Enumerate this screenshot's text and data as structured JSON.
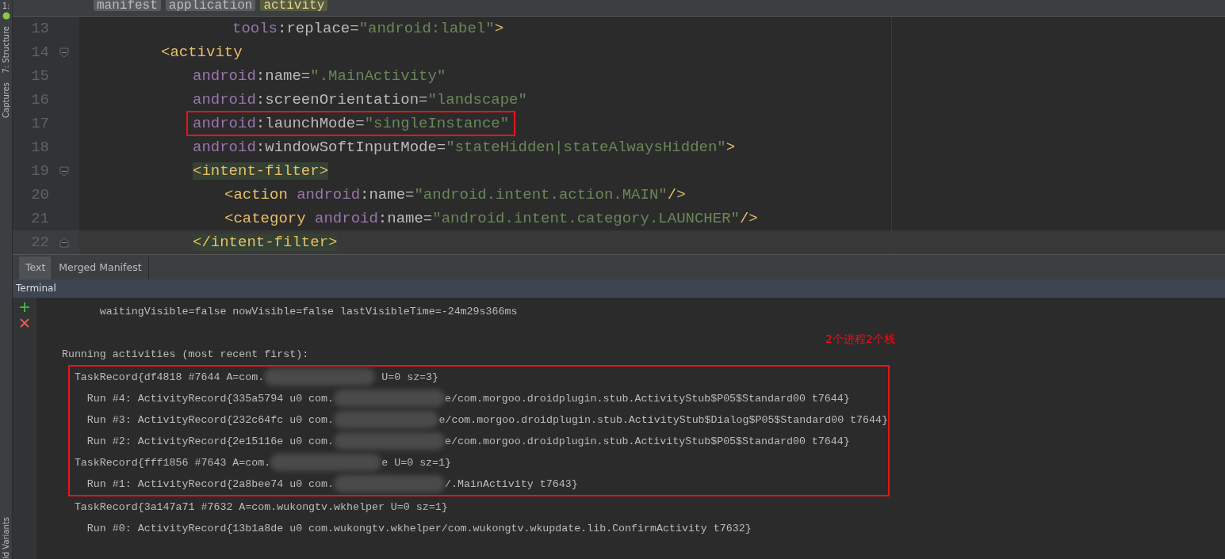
{
  "tool_strip": {
    "top_label": "1:",
    "labels": [
      "7: Structure",
      "Captures"
    ],
    "bottom_label": "ld Variants"
  },
  "breadcrumbs": [
    {
      "label": "manifest",
      "selected": false
    },
    {
      "label": "application",
      "selected": false
    },
    {
      "label": "activity",
      "selected": true
    }
  ],
  "code_lines": [
    {
      "number": "13",
      "kind": "continuation",
      "fold_start": false,
      "fold_end": false,
      "current": false,
      "boxed": false,
      "tokens": [
        {
          "kind": "ns",
          "text": "tools"
        },
        {
          "kind": "punct",
          "text": ":replace="
        },
        {
          "kind": "string",
          "text": "\"android:label\""
        },
        {
          "kind": "tag",
          "text": ">"
        }
      ]
    },
    {
      "number": "14",
      "kind": "element",
      "fold_start": true,
      "fold_end": false,
      "current": false,
      "boxed": false,
      "tokens": [
        {
          "kind": "tag",
          "text": "<activity"
        }
      ],
      "children": [
        {
          "number": "15",
          "kind": "element",
          "fold_start": false,
          "fold_end": false,
          "current": false,
          "boxed": false,
          "tokens": [
            {
              "kind": "ns",
              "text": "android"
            },
            {
              "kind": "punct",
              "text": ":name="
            },
            {
              "kind": "string",
              "text": "\".MainActivity\""
            }
          ]
        },
        {
          "number": "16",
          "kind": "element",
          "fold_start": false,
          "fold_end": false,
          "current": false,
          "boxed": false,
          "tokens": [
            {
              "kind": "ns",
              "text": "android"
            },
            {
              "kind": "punct",
              "text": ":screenOrientation="
            },
            {
              "kind": "string",
              "text": "\"landscape\""
            }
          ]
        },
        {
          "number": "17",
          "kind": "element",
          "fold_start": false,
          "fold_end": false,
          "current": false,
          "boxed": true,
          "tokens": [
            {
              "kind": "ns",
              "text": "android"
            },
            {
              "kind": "punct",
              "text": ":launchMode="
            },
            {
              "kind": "string",
              "text": "\"singleInstance\""
            }
          ]
        },
        {
          "number": "18",
          "kind": "element",
          "fold_start": false,
          "fold_end": false,
          "current": false,
          "boxed": false,
          "tokens": [
            {
              "kind": "ns",
              "text": "android"
            },
            {
              "kind": "punct",
              "text": ":windowSoftInputMode="
            },
            {
              "kind": "string",
              "text": "\"stateHidden|stateAlwaysHidden\""
            },
            {
              "kind": "tag",
              "text": ">"
            }
          ]
        },
        {
          "number": "19",
          "kind": "element",
          "fold_start": true,
          "fold_end": false,
          "current": false,
          "boxed": false,
          "tokens": [
            {
              "kind": "tag-hl",
              "text": "<intent-filter>"
            }
          ],
          "children": [
            {
              "number": "20",
              "kind": "element",
              "fold_start": false,
              "fold_end": false,
              "current": false,
              "boxed": false,
              "tokens": [
                {
                  "kind": "tag",
                  "text": "<action "
                },
                {
                  "kind": "ns",
                  "text": "android"
                },
                {
                  "kind": "punct",
                  "text": ":name="
                },
                {
                  "kind": "string",
                  "text": "\"android.intent.action.MAIN\""
                },
                {
                  "kind": "tag",
                  "text": "/>"
                }
              ]
            },
            {
              "number": "21",
              "kind": "element",
              "fold_start": false,
              "fold_end": false,
              "current": false,
              "boxed": false,
              "tokens": [
                {
                  "kind": "tag",
                  "text": "<category "
                },
                {
                  "kind": "ns",
                  "text": "android"
                },
                {
                  "kind": "punct",
                  "text": ":name="
                },
                {
                  "kind": "string",
                  "text": "\"android.intent.category.LAUNCHER\""
                },
                {
                  "kind": "tag",
                  "text": "/>"
                }
              ]
            }
          ]
        },
        {
          "number": "22",
          "kind": "element",
          "fold_start": false,
          "fold_end": true,
          "current": true,
          "boxed": false,
          "tokens": [
            {
              "kind": "tag-hl",
              "text": "</intent-filter>"
            }
          ]
        }
      ]
    }
  ],
  "editor_tabs": [
    {
      "label": "Text",
      "selected": true
    },
    {
      "label": "Merged Manifest",
      "selected": false
    }
  ],
  "terminal": {
    "title": "Terminal",
    "annotation": "2个进程2个栈",
    "lines": [
      {
        "boxed": false,
        "parts": [
          {
            "kind": "text",
            "text": "          waitingVisible=false nowVisible=false lastVisibleTime=-24m29s366ms"
          }
        ]
      },
      {
        "boxed": false,
        "parts": [
          {
            "kind": "text",
            "text": "    Running activities (most recent first):"
          }
        ]
      },
      {
        "boxed": true,
        "parts": [
          {
            "kind": "text",
            "text": "      TaskRecord{df4818 #7644 A=com."
          },
          {
            "kind": "redacted"
          },
          {
            "kind": "text",
            "text": " U=0 sz=3}"
          }
        ]
      },
      {
        "boxed": true,
        "parts": [
          {
            "kind": "text",
            "text": "        Run #4: ActivityRecord{335a5794 u0 com."
          },
          {
            "kind": "redacted"
          },
          {
            "kind": "text",
            "text": "e/com.morgoo.droidplugin.stub.ActivityStub$P05$Standard00 t7644}"
          }
        ]
      },
      {
        "boxed": true,
        "parts": [
          {
            "kind": "text",
            "text": "        Run #3: ActivityRecord{232c64fc u0 com."
          },
          {
            "kind": "redacted"
          },
          {
            "kind": "text",
            "text": "e/com.morgoo.droidplugin.stub.ActivityStub$Dialog$P05$Standard00 t7644}"
          }
        ]
      },
      {
        "boxed": true,
        "parts": [
          {
            "kind": "text",
            "text": "        Run #2: ActivityRecord{2e15116e u0 com."
          },
          {
            "kind": "redacted"
          },
          {
            "kind": "text",
            "text": "e/com.morgoo.droidplugin.stub.ActivityStub$P05$Standard00 t7644}"
          }
        ]
      },
      {
        "boxed": true,
        "parts": [
          {
            "kind": "text",
            "text": "      TaskRecord{fff1856 #7643 A=com."
          },
          {
            "kind": "redacted"
          },
          {
            "kind": "text",
            "text": "e U=0 sz=1}"
          }
        ]
      },
      {
        "boxed": true,
        "parts": [
          {
            "kind": "text",
            "text": "        Run #1: ActivityRecord{2a8bee74 u0 com."
          },
          {
            "kind": "redacted"
          },
          {
            "kind": "text",
            "text": "/.MainActivity t7643}"
          }
        ]
      },
      {
        "boxed": false,
        "parts": [
          {
            "kind": "text",
            "text": "      TaskRecord{3a147a71 #7632 A=com.wukongtv.wkhelper U=0 sz=1}"
          }
        ]
      },
      {
        "boxed": false,
        "parts": [
          {
            "kind": "text",
            "text": "        Run #0: ActivityRecord{13b1a8de u0 com.wukongtv.wkhelper/com.wukongtv.wkupdate.lib.ConfirmActivity t7632}"
          }
        ]
      }
    ]
  }
}
